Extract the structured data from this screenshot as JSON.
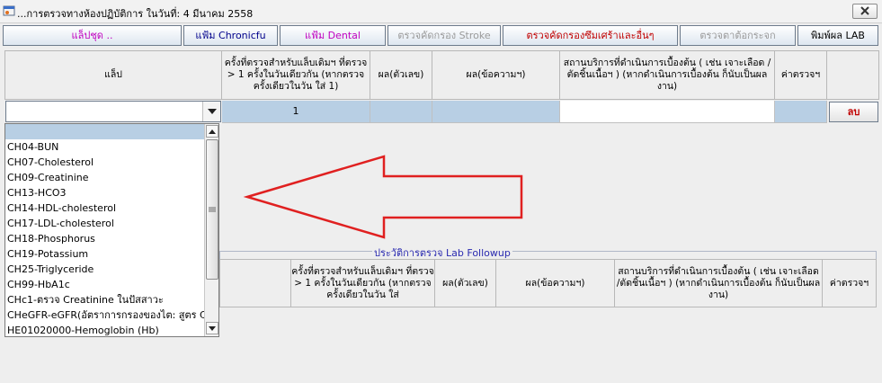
{
  "window": {
    "title": "...การตรวจทางห้องปฏิบัติการ ในวันที่: 4 มีนาคม 2558",
    "close_icon": "close-icon"
  },
  "toolbar": {
    "buttons": [
      {
        "label": "แล็ปชุด ..",
        "color": "#c000c0"
      },
      {
        "label": "แฟ้ม Chronicfu",
        "color": "#00008b"
      },
      {
        "label": "แฟ้ม Dental",
        "color": "#c000c0"
      },
      {
        "label": "ตรวจคัดกรอง Stroke",
        "color": "#9a9a9a"
      },
      {
        "label": "ตรวจคัดกรองซึมเศร้าและอื่นๆ",
        "color": "#c00000"
      },
      {
        "label": "ตรวจตาต้อกระจก",
        "color": "#9a9a9a"
      },
      {
        "label": "พิมพ์ผล LAB",
        "color": "#000000"
      }
    ]
  },
  "grid": {
    "headers": [
      "แล็ป",
      "ครั้งที่ตรวจสำหรับแล็บเดิมฯ ที่ตรวจ > 1 ครั้งในวันเดียวกัน (หากตรวจครั้งเดียวในวัน ใส่ 1)",
      "ผล(ตัวเลข)",
      "ผล(ข้อความฯ)",
      "สถานบริการที่ดำเนินการเบื้องต้น ( เช่น เจาะเลือด /ตัดชิ้นเนื้อฯ ) (หากดำเนินการเบื้องต้น ก็นับเป็นผลงาน)",
      "ค่าตรวจฯ",
      ""
    ],
    "row": {
      "lab_value": "",
      "count": "1",
      "delete_label": "ลบ"
    }
  },
  "dropdown": {
    "items": [
      "",
      "CH04-BUN",
      "CH07-Cholesterol",
      "CH09-Creatinine",
      "CH13-HCO3",
      "CH14-HDL-cholesterol",
      "CH17-LDL-cholesterol",
      "CH18-Phosphorus",
      "CH19-Potassium",
      "CH25-Triglyceride",
      "CH99-HbA1c",
      "CHc1-ตรวจ Creatinine ในปัสสาวะ",
      "CHeGFR-eGFR(อัตราการกรองของไต: สูตร C",
      "HE01020000-Hemoglobin (Hb)"
    ],
    "selected_index": 0
  },
  "followup": {
    "legend": "ประวัติการตรวจ Lab Followup",
    "headers": [
      "ครั้งที่ตรวจสำหรับแล็บเดิมฯ ที่ตรวจ > 1 ครั้งในวันเดียวกัน (หากตรวจครั้งเดียวในวัน ใส่",
      "ผล(ตัวเลข)",
      "ผล(ข้อความฯ)",
      "สถานบริการที่ดำเนินการเบื้องต้น ( เช่น เจาะเลือด /ตัดชิ้นเนื้อฯ ) (หากดำเนินการเบื้องต้น ก็นับเป็นผลงาน)",
      "ค่าตรวจฯ"
    ]
  },
  "annotation": {
    "arrow_color": "#e02020"
  }
}
